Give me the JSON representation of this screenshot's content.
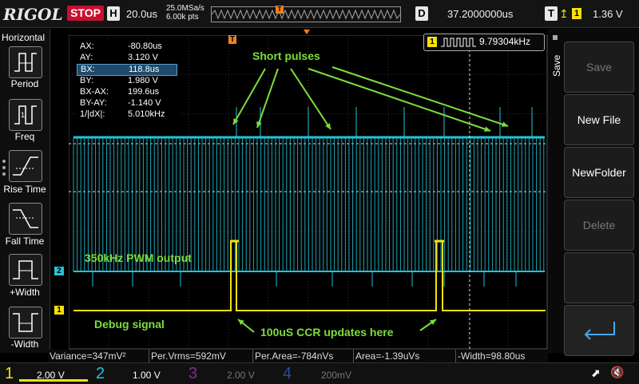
{
  "header": {
    "brand": "RIGOL",
    "run_state": "STOP",
    "h_label": "H",
    "timebase": "20.0us",
    "sample_rate": "25.0MSa/s",
    "mem_depth": "6.00k pts",
    "d_label": "D",
    "delay": "37.2000000us",
    "t_label": "T",
    "trigger_channel": "1",
    "trigger_level": "1.36 V"
  },
  "left_menu": {
    "title": "Horizontal",
    "items": [
      {
        "label": "Period",
        "icon": "period-icon"
      },
      {
        "label": "Freq",
        "icon": "freq-icon"
      },
      {
        "label": "Rise Time",
        "icon": "rise-time-icon"
      },
      {
        "label": "Fall Time",
        "icon": "fall-time-icon"
      },
      {
        "label": "+Width",
        "icon": "pos-width-icon"
      },
      {
        "label": "-Width",
        "icon": "neg-width-icon"
      }
    ]
  },
  "right_menu": {
    "title": "Save",
    "items": [
      {
        "label": "Save",
        "enabled": false
      },
      {
        "label": "New File",
        "enabled": true
      },
      {
        "label": "NewFolder",
        "enabled": true
      },
      {
        "label": "Delete",
        "enabled": false
      }
    ],
    "back_icon": "return-arrow-icon"
  },
  "cursors": [
    {
      "name": "AX:",
      "value": "-80.80us"
    },
    {
      "name": "AY:",
      "value": "3.120 V"
    },
    {
      "name": "BX:",
      "value": "118.8us"
    },
    {
      "name": "BY:",
      "value": "1.980 V"
    },
    {
      "name": "BX-AX:",
      "value": "199.6us"
    },
    {
      "name": "BY-AY:",
      "value": "-1.140 V"
    },
    {
      "name": "1/|dX|:",
      "value": "5.010kHz"
    }
  ],
  "freq_counter": {
    "channel": "1",
    "value": "9.79304kHz"
  },
  "annotations": {
    "short_pulses": "Short pulses",
    "pwm_output": "350kHz PWM output",
    "debug_signal": "Debug signal",
    "ccr_updates": "100uS CCR updates here"
  },
  "channel_markers": {
    "ch1": "1",
    "ch2": "2",
    "trigger_marker": "T"
  },
  "measurements": [
    {
      "label": "Variance=347mV²"
    },
    {
      "label": "Per.Vrms=592mV"
    },
    {
      "label": "Per.Area=-784nVs"
    },
    {
      "label": "Area=-1.39uVs"
    },
    {
      "label": "-Width=98.80us"
    }
  ],
  "channels": [
    {
      "num": "1",
      "scale": "2.00 V",
      "color": "#f5e10b",
      "active": true
    },
    {
      "num": "2",
      "scale": "1.00 V",
      "color": "#22c4d6",
      "active": true
    },
    {
      "num": "3",
      "scale": "2.00 V",
      "color": "#c040c0",
      "active": false
    },
    {
      "num": "4",
      "scale": "200mV",
      "color": "#3a6ee8",
      "active": false
    }
  ],
  "colors": {
    "ch1": "#f5e10b",
    "ch2": "#22c4d6",
    "annotation": "#7dde3a",
    "stop": "#c8102e"
  }
}
